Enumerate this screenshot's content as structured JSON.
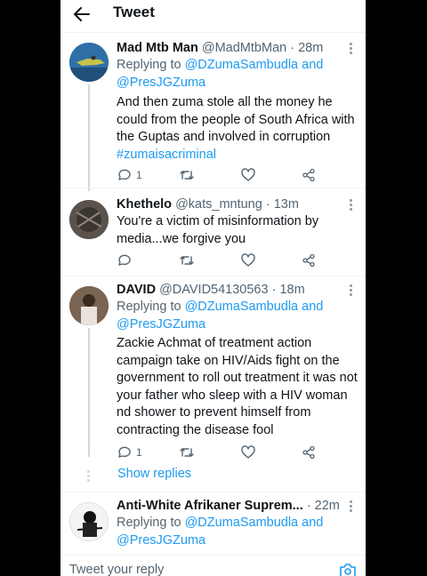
{
  "header": {
    "title": "Tweet",
    "back_icon": "arrow-left-icon"
  },
  "tweets": [
    {
      "name": "Mad Mtb Man",
      "handle": "@MadMtbMan",
      "sep": " · ",
      "time": "28m",
      "reply_prefix": "Replying to ",
      "reply_user1": "@DZumaSambudla",
      "reply_and": " and",
      "reply_user2": "@PresJGZuma",
      "text": "And then zuma stole all the money he could from the people of South Africa with the Guptas and involved in corruption ",
      "hashtag": "#zumaisacriminal",
      "reply_count": "1"
    },
    {
      "name": "Khethelo",
      "handle": "@kats_mntung",
      "sep": " · ",
      "time": "13m",
      "text": "You're a victim of misinformation by media...we forgive you"
    },
    {
      "name": "DAVID",
      "handle": "@DAVID54130563",
      "sep": " · ",
      "time": "18m",
      "reply_prefix": "Replying to ",
      "reply_user1": "@DZumaSambudla",
      "reply_and": " and",
      "reply_user2": "@PresJGZuma",
      "text": "Zackie Achmat of treatment action campaign take on HIV/Aids fight on the government to roll out treatment it was not your father who sleep with a HIV woman nd shower to prevent himself from contracting the disease fool",
      "reply_count": "1"
    },
    {
      "name": "Anti-White Afrikaner Suprem...",
      "sep": " · ",
      "time": "22m",
      "reply_prefix": "Replying to ",
      "reply_user1": "@DZumaSambudla",
      "reply_and": " and",
      "reply_user2": "@PresJGZuma"
    }
  ],
  "show_replies": "Show replies",
  "reply_bar": {
    "placeholder": "Tweet your reply"
  },
  "colors": {
    "link": "#1d9bf0",
    "muted": "#536471",
    "text": "#0f1419",
    "border": "#eff3f4"
  },
  "icons": [
    "reply-icon",
    "retweet-icon",
    "like-icon",
    "share-icon",
    "more-icon",
    "camera-icon"
  ]
}
